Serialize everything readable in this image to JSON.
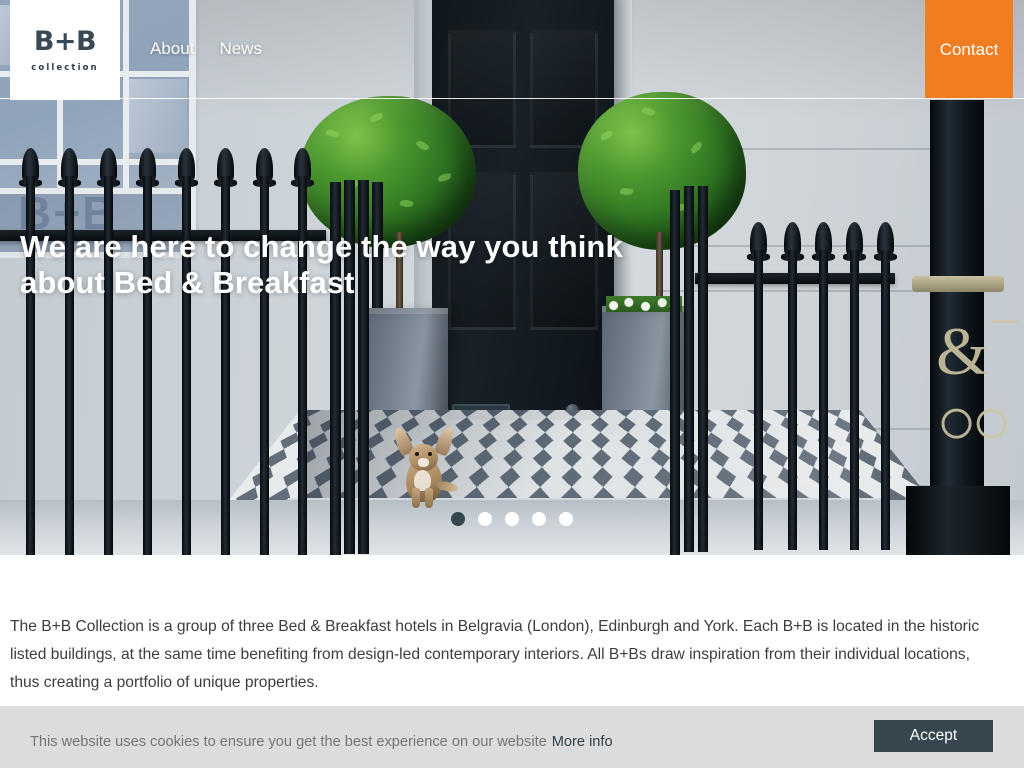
{
  "site": {
    "logo": {
      "mark": "B+B",
      "sub": "collection"
    }
  },
  "header": {
    "nav": [
      {
        "label": "About"
      },
      {
        "label": "News"
      }
    ],
    "contact_label": "Contact",
    "contact_color": "#f07d22"
  },
  "hero": {
    "headline": "We are here to change the way you think about Bed & Breakfast",
    "carousel": {
      "total": 5,
      "active_index": 0,
      "active_color": "#36474f",
      "inactive_color": "#ffffff"
    },
    "image_description": "Georgian townhouse entrance with black iron railing, topiary trees in grey planters, black front door, chihuahua on checkered tiled porch, black and gold lamp post"
  },
  "main": {
    "intro": "The B+B Collection is a group of three Bed & Breakfast hotels in Belgravia (London), Edinburgh and York. Each B+B is located in the historic listed buildings, at the same time benefiting from design-led contemporary interiors. All B+Bs draw inspiration from their individual locations, thus creating a portfolio of unique properties."
  },
  "cookie": {
    "message": "This website uses cookies to ensure you get the best experience on our website",
    "more_info_label": "More info",
    "accept_label": "Accept",
    "background": "#dcdcdc",
    "accept_color": "#36474f"
  }
}
